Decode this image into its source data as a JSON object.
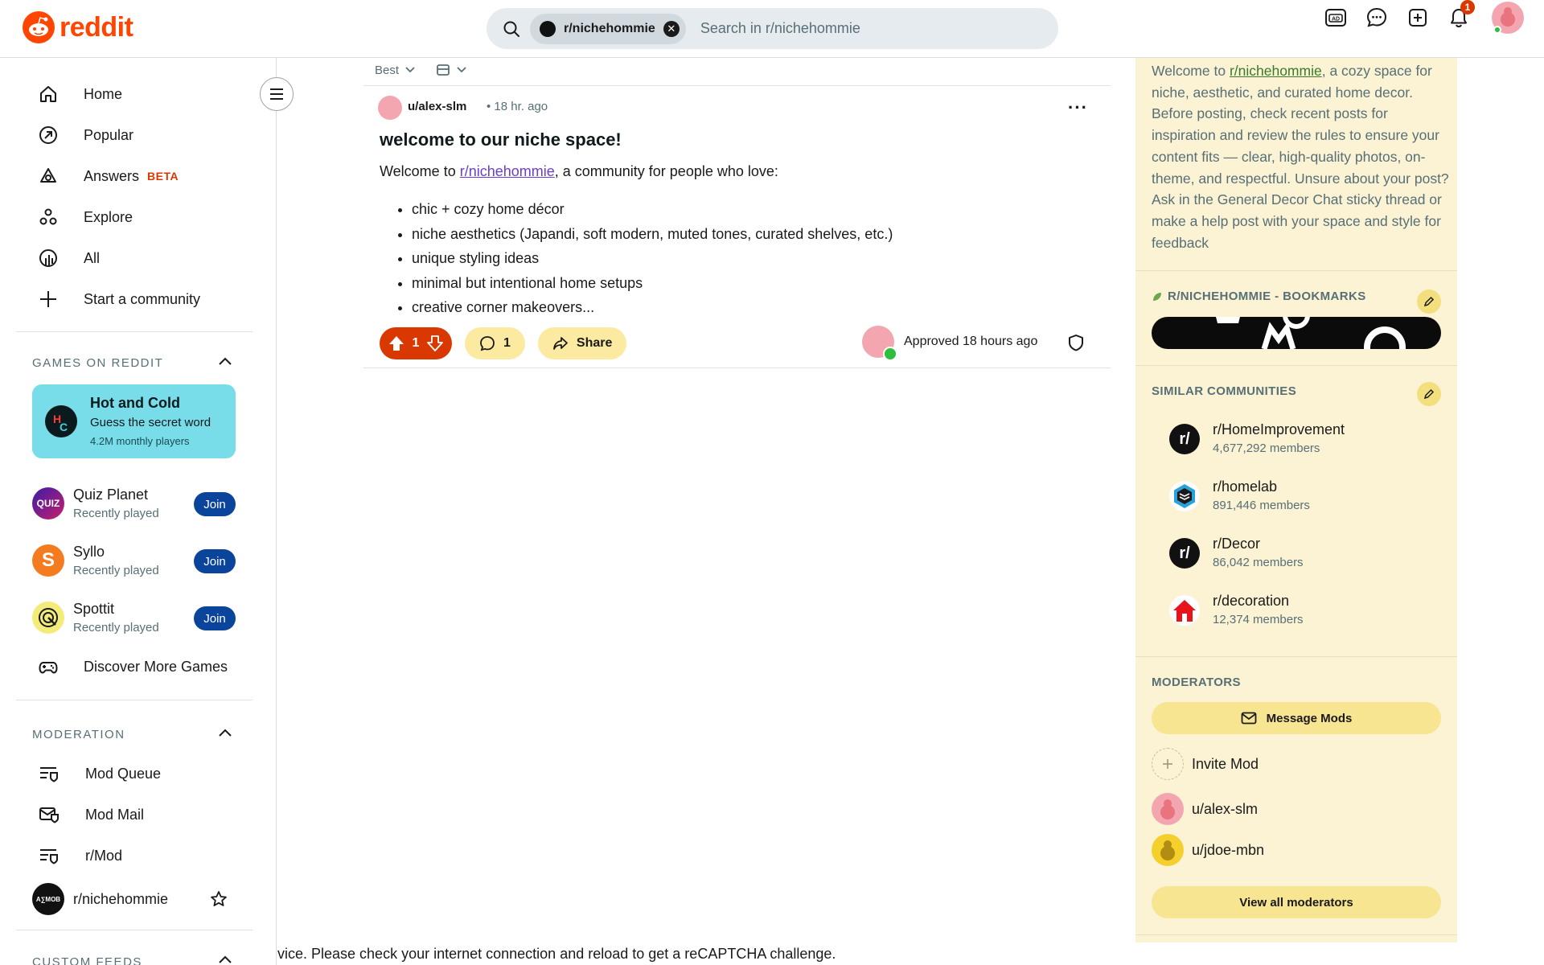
{
  "topbar": {
    "logo_text": "reddit",
    "search": {
      "chip_label": "r/nichehommie",
      "placeholder": "Search in r/nichehommie"
    },
    "notification_count": "1"
  },
  "sidebar": {
    "nav": [
      {
        "label": "Home",
        "icon": "home-icon"
      },
      {
        "label": "Popular",
        "icon": "popular-icon"
      },
      {
        "label": "Answers",
        "icon": "answers-icon",
        "badge": "BETA"
      },
      {
        "label": "Explore",
        "icon": "explore-icon"
      },
      {
        "label": "All",
        "icon": "all-icon"
      },
      {
        "label": "Start a community",
        "icon": "plus-icon"
      }
    ],
    "games_section_title": "GAMES ON REDDIT",
    "featured_game": {
      "title": "Hot and Cold",
      "subtitle": "Guess the secret word",
      "players": "4.2M monthly players"
    },
    "games": [
      {
        "name": "Quiz Planet",
        "status": "Recently played",
        "join": "Join"
      },
      {
        "name": "Syllo",
        "status": "Recently played",
        "join": "Join"
      },
      {
        "name": "Spottit",
        "status": "Recently played",
        "join": "Join"
      }
    ],
    "discover_games": "Discover More Games",
    "moderation_section_title": "MODERATION",
    "moderation": [
      {
        "label": "Mod Queue"
      },
      {
        "label": "Mod Mail"
      },
      {
        "label": "r/Mod"
      },
      {
        "label": "r/nichehommie"
      }
    ],
    "custom_feeds_title": "CUSTOM FEEDS"
  },
  "main": {
    "sort_label": "Best",
    "post": {
      "author": "u/alex-slm",
      "time": "• 18 hr. ago",
      "title": "welcome to our niche space!",
      "intro_prefix": "Welcome to ",
      "intro_link": "r/nichehommie",
      "intro_suffix": ", a community for people who love:",
      "bullets": [
        "chic + cozy home décor",
        "niche aesthetics (Japandi, soft modern, muted tones, curated shelves, etc.)",
        "unique styling ideas",
        "minimal but intentional home setups",
        "creative corner makeovers..."
      ],
      "votes": "1",
      "comments": "1",
      "share_label": "Share",
      "approved_text": "Approved 18 hours ago"
    }
  },
  "recaptcha_text": "vice. Please check your internet connection and reload to get a reCAPTCHA challenge.",
  "right": {
    "description_prefix": "Welcome to ",
    "description_link": "r/nichehommie",
    "description_suffix": ", a cozy space for niche, aesthetic, and curated home decor. Before posting, check recent posts for inspiration and review the rules to ensure your content fits — clear, high-quality photos, on-theme, and respectful. Unsure about your post? Ask in the General Decor Chat sticky thread or make a help post with your space and style for feedback",
    "bookmarks_title": "R/NICHEHOMMIE - BOOKMARKS",
    "similar_title": "SIMILAR COMMUNITIES",
    "communities": [
      {
        "name": "r/HomeImprovement",
        "members": "4,677,292 members"
      },
      {
        "name": "r/homelab",
        "members": "891,446 members"
      },
      {
        "name": "r/Decor",
        "members": "86,042 members"
      },
      {
        "name": "r/decoration",
        "members": "12,374 members"
      }
    ],
    "moderators_title": "MODERATORS",
    "message_mods": "Message Mods",
    "invite_mod": "Invite Mod",
    "moderators": [
      {
        "name": "u/alex-slm"
      },
      {
        "name": "u/jdoe-mbn"
      }
    ],
    "view_all_mods": "View all moderators"
  },
  "colors": {
    "brand": "#ff4500",
    "upvote_pill": "#d93900",
    "join_button": "#0a449b",
    "sidebar_bg": "#fbf3d4"
  }
}
